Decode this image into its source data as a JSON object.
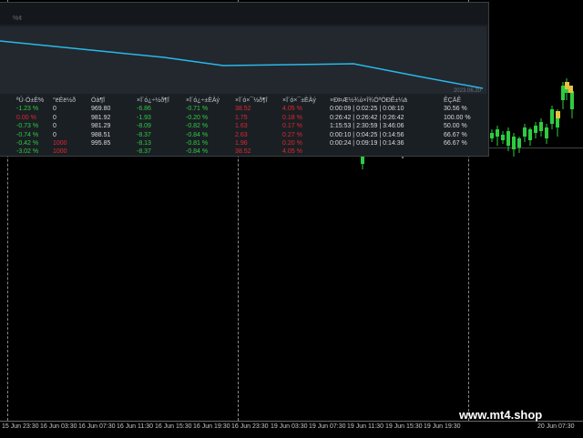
{
  "panel": {
    "title": "%¢",
    "graph_date": "2023.06.20"
  },
  "table": {
    "headers": [
      "ªÛ·Ó±È%",
      "°ëÈë½ð",
      "Óà¶î",
      "×î´ó¿÷½ð¶î",
      "×î´ó¿÷±ÈÀý",
      "×î´ó×¯½ð¶î",
      "×î´ó×¯±ÈÀý",
      "×ÐÞÆ½¾ù×î¾ÓºÓÐÊ±¼ä",
      "ÊÇÄÊ"
    ],
    "rows": [
      {
        "c0": "-1.23 %",
        "c1": "0",
        "c2": "969.80",
        "c3": "-6.86",
        "c4": "-0.71 %",
        "c5": "38.52",
        "c6": "4.05 %",
        "c7": "0:00:09 | 0:02:25 | 0:08:10",
        "c8": "30.56 %",
        "k0": "g",
        "k1": "w",
        "k5": "r",
        "k6": "r"
      },
      {
        "c0": "0.00 %",
        "c1": "0",
        "c2": "981.92",
        "c3": "-1.93",
        "c4": "-0.20 %",
        "c5": "1.75",
        "c6": "0.18 %",
        "c7": "0:26:42 | 0:26:42 | 0:26:42",
        "c8": "100.00 %",
        "k0": "r",
        "k1": "w",
        "k5": "r",
        "k6": "r"
      },
      {
        "c0": "-0.73 %",
        "c1": "0",
        "c2": "981.29",
        "c3": "-8.09",
        "c4": "-0.82 %",
        "c5": "1.63",
        "c6": "0.17 %",
        "c7": "1:15:53 | 2:30:59 | 3:46:06",
        "c8": "50.00 %",
        "k0": "g",
        "k1": "w",
        "k5": "r",
        "k6": "r"
      },
      {
        "c0": "-0.74 %",
        "c1": "0",
        "c2": "988.51",
        "c3": "-8.37",
        "c4": "-0.84 %",
        "c5": "2.63",
        "c6": "0.27 %",
        "c7": "0:00:10 | 0:04:25 | 0:14:56",
        "c8": "66.67 %",
        "k0": "g",
        "k1": "w",
        "k5": "r",
        "k6": "r"
      },
      {
        "c0": "-0.42 %",
        "c1": "1000",
        "c2": "995.85",
        "c3": "-8.13",
        "c4": "-0.81 %",
        "c5": "1.96",
        "c6": "0.20 %",
        "c7": "0:00:24 | 0:09:19 | 0:14:36",
        "c8": "66.67 %",
        "k0": "g",
        "k1": "r",
        "k5": "r",
        "k6": "r"
      },
      {
        "c0": "-3.02 %",
        "c1": "1000",
        "c2": "",
        "c3": "-8.37",
        "c4": "-0.84 %",
        "c5": "38.52",
        "c6": "4.05 %",
        "c7": "",
        "c8": "",
        "k0": "g",
        "k1": "r",
        "k5": "r",
        "k6": "r"
      }
    ]
  },
  "xaxis": [
    "15 Jun 23:30",
    "16 Jun 03:30",
    "16 Jun 07:30",
    "16 Jun 11:30",
    "16 Jun 15:30",
    "16 Jun 19:30",
    "16 Jun 23:30",
    "19 Jun 03:30",
    "19 Jun 07:30",
    "19 Jun 11:30",
    "19 Jun 15:30",
    "19 Jun 19:30",
    "20 Jun 07:30"
  ],
  "watermark": "www.mt4.shop",
  "colors": {
    "line": "#2ab8e8",
    "profit": "#2ecc40",
    "loss": "#e0282e",
    "background": "#000000"
  }
}
